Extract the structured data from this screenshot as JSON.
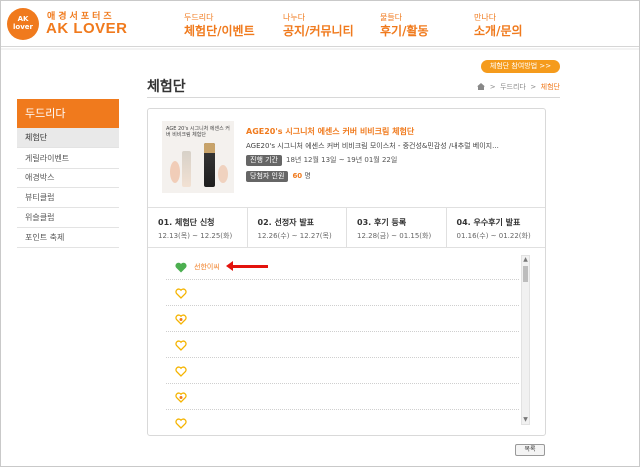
{
  "header": {
    "logo_circle": "AK lover",
    "logo_sub": "애경서포터즈",
    "logo_main": "AK LOVER",
    "nav": [
      {
        "sub": "두드리다",
        "main": "체험단/이벤트"
      },
      {
        "sub": "나누다",
        "main": "공지/커뮤니티"
      },
      {
        "sub": "물들다",
        "main": "후기/활동"
      },
      {
        "sub": "만나다",
        "main": "소개/문의"
      }
    ]
  },
  "page": {
    "title": "체험단",
    "guide_button": "체험단 참여방법 >>",
    "breadcrumb": [
      "두드리다",
      "체험단"
    ]
  },
  "sidebar": {
    "heading": "두드리다",
    "items": [
      "체험단",
      "게릴라이벤트",
      "애경박스",
      "뷰티클럽",
      "위슬클럽",
      "포인트 축제"
    ]
  },
  "product": {
    "image_caption": "AGE 20's 시그니처 에센스 커버 비비크림 체험단",
    "title": "AGE20's 시그니처 에센스 커버 비비크림 체험단",
    "description": "AGE20's 시그니처 에센스 커버 비비크림 모이스처 - 중건성&민감성 /내추럴 베이지...",
    "period_label": "진행 기간",
    "period_value": "18년 12월 13일 ~ 19년 01월 22일",
    "winners_label": "당첨자 인원",
    "winners_count": "60",
    "winners_unit": "명"
  },
  "steps": [
    {
      "title": "01. 체험단 신청",
      "date": "12.13(목) ~ 12.25(화)"
    },
    {
      "title": "02. 선정자 발표",
      "date": "12.26(수) ~ 12.27(목)"
    },
    {
      "title": "03. 후기 등록",
      "date": "12.28(금) ~ 01.15(화)"
    },
    {
      "title": "04. 우수후기 발표",
      "date": "01.16(수) ~ 01.22(화)"
    }
  ],
  "list": {
    "first_item": "선한이씨",
    "colors": {
      "active_heart": "#4caf50",
      "heart": "#f5b400",
      "accent": "#f07a1d",
      "arrow": "#e3130d"
    }
  },
  "footer": {
    "list_button": "목록"
  }
}
